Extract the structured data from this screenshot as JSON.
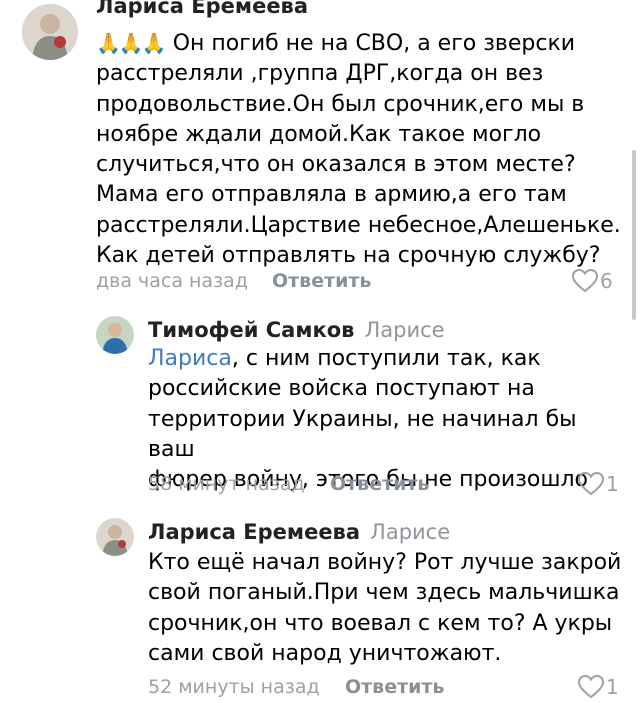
{
  "comments": [
    {
      "author": "Лариса Еремеева",
      "emoji": "🙏🙏🙏",
      "lines": [
        "Он погиб не на СВО, а его зверски",
        "расстреляли ,группа ДРГ,когда он вез",
        "продовольствие.Он был срочник,его мы в",
        "ноябре ждали домой.Как такое могло",
        "случиться,что он оказался в этом месте?",
        "Мама его отправляла в армию,а его там",
        "расстреляли.Царствие небесное,Алешеньке.",
        "Как детей отправлять на срочную службу?"
      ],
      "time": "два часа назад",
      "reply_label": "Ответить",
      "likes": "6",
      "colors": {
        "avatar_bg": "#d7d2c8",
        "avatar_fg": "#b23a3a"
      }
    },
    {
      "author": "Тимофей Самков",
      "reply_to": "Ларисе",
      "mention": "Лариса",
      "first_line_rest": ", с ним поступили так, как",
      "lines": [
        "российские войска поступают на",
        "территории Украины, не начинал бы ваш",
        "фюрер войну, этого бы не произошло"
      ],
      "time": "58 минут назад",
      "reply_label": "Ответить",
      "likes": "1",
      "colors": {
        "avatar_bg": "#c7d6c3",
        "avatar_fg": "#2d6db0"
      }
    },
    {
      "author": "Лариса Еремеева",
      "reply_to": "Ларисе",
      "lines": [
        "Кто ещё начал войну? Рот лучше закрой",
        "свой поганый.При чем здесь мальчишка",
        "срочник,он что воевал с кем то? А укры",
        "сами свой народ уничтожают."
      ],
      "time": "52 минуты назад",
      "reply_label": "Ответить",
      "likes": "1",
      "colors": {
        "avatar_bg": "#d7d2c8",
        "avatar_fg": "#b23a3a"
      }
    }
  ],
  "icons": {
    "like": "heart-outline-icon",
    "avatar": "avatar"
  },
  "colors": {
    "text": "#000000",
    "author": "#222222",
    "muted": "#9ca1a7",
    "mention": "#3f7bc0",
    "reply_button": "#8a9098"
  }
}
